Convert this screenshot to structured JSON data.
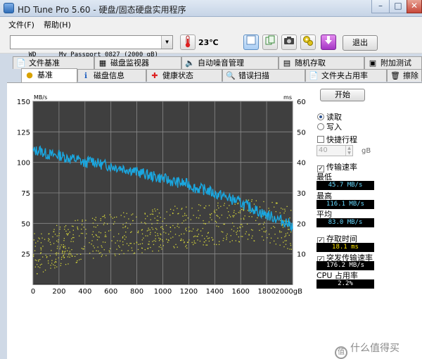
{
  "window": {
    "title": "HD Tune Pro 5.60 - 硬盘/固态硬盘实用程序",
    "controls": [
      "minimize",
      "maximize",
      "close"
    ]
  },
  "menu": {
    "file": "文件(F)",
    "help": "帮助(H)"
  },
  "toolbar": {
    "drive": "WD      My Passport 0827 (2000 gB)",
    "temperature": "23℃",
    "exit": "退出",
    "icons": [
      "thermometer-icon",
      "info-icon",
      "copy-icon",
      "camera-icon",
      "settings-icon",
      "download-icon"
    ]
  },
  "tabs": {
    "top": [
      "文件基准",
      "磁盘监视器",
      "自动噪音管理",
      "随机存取",
      "附加测试"
    ],
    "bottom": [
      "基准",
      "磁盘信息",
      "健康状态",
      "错误扫描",
      "文件夹占用率",
      "擦除"
    ],
    "active": "基准"
  },
  "side": {
    "start": "开始",
    "read": "读取",
    "write": "写入",
    "quick_stroke": "快捷行程",
    "quick_value": "40",
    "quick_unit": "gB",
    "transfer_rate": "传输速率",
    "min_label": "最低",
    "min_value": "45.7 MB/s",
    "max_label": "最高",
    "max_value": "116.1 MB/s",
    "avg_label": "平均",
    "avg_value": "83.0 MB/s",
    "access_time": "存取时间",
    "access_value": "18.1 ms",
    "burst_rate": "突发传输速率",
    "burst_value": "176.2 MB/s",
    "cpu_label": "CPU 占用率",
    "cpu_value": "2.2%"
  },
  "watermark": "什么值得买",
  "colors": {
    "plot_bg": "#3f3f3f",
    "grid": "#8a8a8a",
    "transfer_line": "#1aa7e0",
    "access_points": "#d6d63a"
  },
  "chart_data": {
    "type": "line",
    "left_axis_unit": "MB/s",
    "right_axis_unit": "ms",
    "x_unit": "gB",
    "xlim": [
      0,
      2000
    ],
    "ylim_left": [
      0,
      150
    ],
    "ylim_right": [
      0,
      60
    ],
    "x_ticks": [
      "0",
      "200",
      "400",
      "600",
      "800",
      "1000",
      "1200",
      "1400",
      "1600",
      "1800",
      "2000gB"
    ],
    "y_ticks_left": [
      "25",
      "50",
      "75",
      "100",
      "125",
      "150"
    ],
    "y_ticks_right": [
      "10",
      "20",
      "30",
      "40",
      "50",
      "60"
    ],
    "grid": true,
    "series": [
      {
        "axis": "left",
        "x": [
          0,
          50,
          100,
          150,
          200,
          250,
          300,
          350,
          400,
          450,
          500,
          550,
          600,
          650,
          700,
          750,
          800,
          850,
          900,
          950,
          1000,
          1050,
          1100,
          1150,
          1200,
          1250,
          1300,
          1350,
          1400,
          1450,
          1500,
          1550,
          1600,
          1650,
          1700,
          1750,
          1800,
          1850,
          1900,
          1950,
          2000
        ],
        "values": [
          109,
          110,
          107,
          106,
          106,
          104,
          103,
          102,
          99,
          102,
          99,
          98,
          97,
          96,
          95,
          94,
          92,
          91,
          89,
          88,
          87,
          85,
          84,
          83,
          82,
          79,
          78,
          77,
          74,
          73,
          71,
          69,
          67,
          64,
          62,
          59,
          57,
          55,
          53,
          51,
          48
        ]
      },
      {
        "axis": "right",
        "type": "scatter",
        "x": [
          0,
          100,
          200,
          300,
          400,
          500,
          600,
          700,
          800,
          900,
          1000,
          1100,
          1200,
          1300,
          1400,
          1500,
          1600,
          1700,
          1800,
          1900,
          2000
        ],
        "values": [
          10,
          11,
          13,
          14,
          15,
          16,
          16,
          17,
          17,
          18,
          18,
          19,
          19,
          20,
          20,
          20,
          21,
          21,
          21,
          20,
          18
        ]
      }
    ]
  }
}
